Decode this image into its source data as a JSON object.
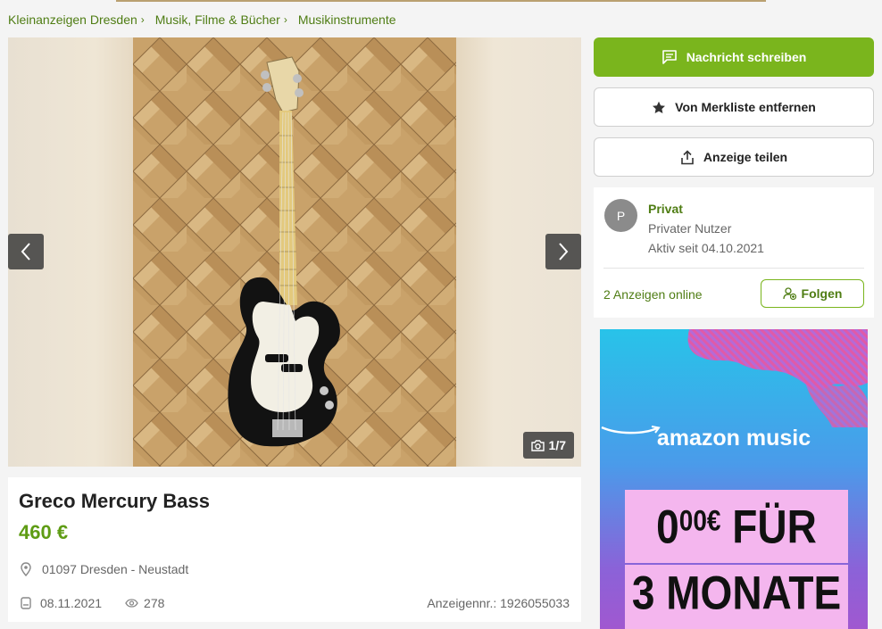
{
  "breadcrumb": [
    {
      "label": "Kleinanzeigen Dresden"
    },
    {
      "label": "Musik, Filme & Bücher"
    },
    {
      "label": "Musikinstrumente"
    }
  ],
  "gallery": {
    "counter": "1/7"
  },
  "listing": {
    "title": "Greco Mercury Bass",
    "price": "460 €",
    "location": "01097 Dresden - Neustadt",
    "date": "08.11.2021",
    "views": "278",
    "ad_number": "Anzeigennr.: 1926055033"
  },
  "actions": {
    "message": "Nachricht schreiben",
    "watchlist": "Von Merkliste entfernen",
    "share": "Anzeige teilen"
  },
  "seller": {
    "avatar_letter": "P",
    "name": "Privat",
    "type": "Privater Nutzer",
    "active_since": "Aktiv seit 04.10.2021",
    "ads_online": "2 Anzeigen online",
    "follow": "Folgen"
  },
  "ad_banner": {
    "brand": "amazon music",
    "offer_amount": "0",
    "offer_cents": "00€",
    "offer_line1_suffix": " FÜR",
    "offer_line2": "3 MONATE"
  },
  "colors": {
    "accent": "#7ab51d",
    "link": "#4f7d14",
    "price": "#5e9c14"
  }
}
